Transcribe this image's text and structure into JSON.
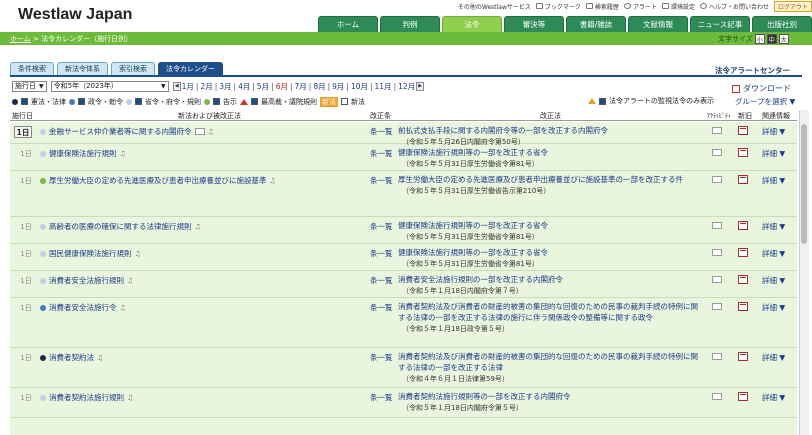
{
  "brand": "Westlaw Japan",
  "utility": {
    "contact": "その他のWestlawサービス",
    "bookmark": "ブックマーク",
    "history": "検索履歴",
    "alert": "アラート",
    "settings": "環境設定",
    "help": "ヘルプ・お問い合わせ",
    "logout": "ログアウト"
  },
  "nav": [
    "ホーム",
    "判例",
    "法令",
    "審決等",
    "書籍/雑誌",
    "文献情報",
    "ニュース記事",
    "出版社別"
  ],
  "nav_active_index": 2,
  "breadcrumb": {
    "home": "ホーム",
    "rest": " > 法令カレンダー（施行日別）"
  },
  "fontsize": {
    "label": "文字サイズ",
    "small": "小",
    "medium": "中",
    "large": "大"
  },
  "subtabs": [
    "条件検索",
    "新法令体系",
    "索引検索",
    "法令カレンダー"
  ],
  "subtab_active_index": 3,
  "alert_center": "法令アラートセンター",
  "download": "ダウンロード",
  "controls": {
    "mode": "施行日",
    "year": "令和5年（2023年）",
    "months": [
      "1月",
      "2月",
      "3月",
      "4月",
      "5月",
      "6月",
      "7月",
      "8月",
      "9月",
      "10月",
      "11月",
      "12月"
    ],
    "current_month_index": 5
  },
  "filters": {
    "law": "憲法・法律",
    "ordinance": "政令・勅令",
    "ministerial": "省令・府令・規則",
    "notice": "告示",
    "court": "最高裁・議院規則",
    "new_badge": "新法",
    "new_label": "新法"
  },
  "monitor_label": "法令アラートの監視法令のみ表示",
  "group_select": "グループを選択",
  "table": {
    "headers": {
      "date": "施行日",
      "title": "新法および被改正法",
      "jo": "改正条",
      "amend": "改正法",
      "activity": "ｱｸﾃｨﾋﾞﾃｨ",
      "new": "新旧",
      "related": "関連情報"
    },
    "rows": [
      {
        "date": "1日",
        "title": "金融サービス仲介業者等に関する内閣府令",
        "jo": "条一覧",
        "amend": "前払式支払手段に関する内閣府令等の一部を改正する内閣府令",
        "note": "（令和５年５月26日内閣府令第50号）",
        "detail": "詳細",
        "dot": "#bcd0ea"
      },
      {
        "date": "1日",
        "title": "健康保険法施行規則",
        "jo": "条一覧",
        "amend": "健康保険法施行規則等の一部を改正する省令",
        "note": "（令和５年５月31日厚生労働省令第81号）",
        "detail": "詳細",
        "dot": "#bcd0ea"
      },
      {
        "date": "1日",
        "title": "厚生労働大臣の定める先進医療及び患者申出療養並びに施設基準",
        "jo": "条一覧",
        "amend": "厚生労働大臣の定める先進医療及び患者申出療養並びに施設基準の一部を改正する件",
        "note": "（令和５年５月31日厚生労働省告示第210号）",
        "detail": "詳細",
        "dot": "#7ab648"
      },
      {
        "date": "1日",
        "title": "高齢者の医療の確保に関する法律施行規則",
        "jo": "条一覧",
        "amend": "健康保険法施行規則等の一部を改正する省令",
        "note": "（令和５年５月31日厚生労働省令第81号）",
        "detail": "詳細",
        "dot": "#bcd0ea"
      },
      {
        "date": "1日",
        "title": "国民健康保険法施行規則",
        "jo": "条一覧",
        "amend": "健康保険法施行規則等の一部を改正する省令",
        "note": "（令和５年５月31日厚生労働省令第81号）",
        "detail": "詳細",
        "dot": "#bcd0ea"
      },
      {
        "date": "1日",
        "title": "消費者安全法施行規則",
        "jo": "条一覧",
        "amend": "消費者安全法施行規則の一部を改正する内閣府令",
        "note": "（令和５年１月18日内閣府令第７号）",
        "detail": "詳細",
        "dot": "#bcd0ea"
      },
      {
        "date": "1日",
        "title": "消費者安全法施行令",
        "jo": "条一覧",
        "amend": "消費者契約法及び消費者の財産的被害の集団的な回復のための民事の裁判手続の特例に関する法律の一部を改正する法律の施行に伴う関係政令の整備等に関する政令",
        "note": "（令和５年１月18日政令第５号）",
        "detail": "詳細",
        "dot": "#4a78c0"
      },
      {
        "date": "1日",
        "title": "消費者契約法",
        "jo": "条一覧",
        "amend": "消費者契約法及び消費者の財産的被害の集団的な回復のための民事の裁判手続の特例に関する法律の一部を改正する法律",
        "note": "（令和４年６月１日法律第59号）",
        "detail": "詳細",
        "dot": "#1a2a4a"
      },
      {
        "date": "1日",
        "title": "消費者契約法施行規則",
        "jo": "条一覧",
        "amend": "消費者契約法施行規則等の一部を改正する内閣府令",
        "note": "（令和５年１月18日内閣府令第５号）",
        "detail": "詳細",
        "dot": "#bcd0ea"
      }
    ]
  }
}
